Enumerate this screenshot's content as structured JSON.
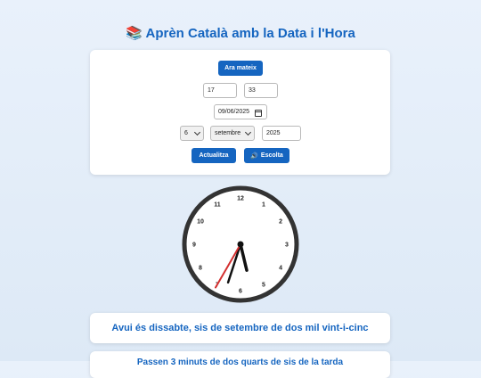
{
  "header": {
    "icon": "books-icon",
    "icon_glyph": "📚",
    "title": "Aprèn Català amb la Data i l'Hora"
  },
  "controls": {
    "now_button": "Ara mateix",
    "hour_value": "17",
    "minute_value": "33",
    "date_value": "09/06/2025",
    "day_value": "6",
    "month_value": "setembre",
    "year_value": "2025",
    "update_button": "Actualitza",
    "listen_icon": "speaker-icon",
    "listen_glyph": "🔊",
    "listen_button": "Escolta"
  },
  "clock": {
    "numbers": [
      "12",
      "1",
      "2",
      "3",
      "4",
      "5",
      "6",
      "7",
      "8",
      "9",
      "10",
      "11"
    ],
    "hour": 17,
    "minute": 33,
    "second": 35,
    "colors": {
      "face": "#ffffff",
      "rim": "#333333",
      "hands": "#111111",
      "second_hand": "#d32f2f"
    }
  },
  "date_sentence": "Avui és dissabte, sis de setembre de dos mil vint-i-cinc",
  "time_sentence": "Passen 3 minuts de dos quarts de sis de la tarda",
  "colors": {
    "accent": "#1565c0"
  }
}
